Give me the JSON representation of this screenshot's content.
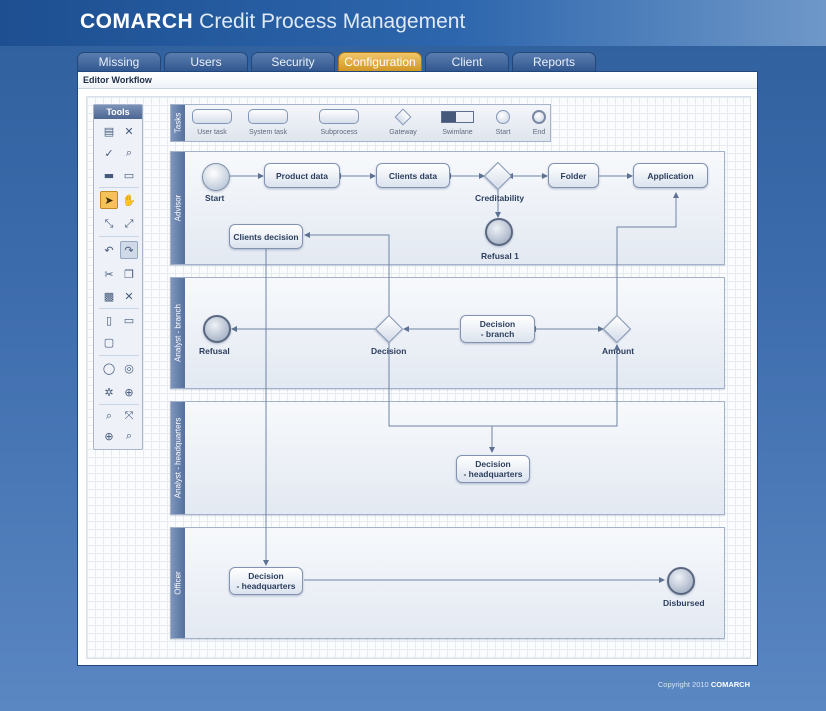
{
  "app": {
    "brand_strong": "COMARCH",
    "brand_rest": "Credit Process Management"
  },
  "tabs": [
    {
      "label": "Missing",
      "active": false
    },
    {
      "label": "Users",
      "active": false
    },
    {
      "label": "Security",
      "active": false
    },
    {
      "label": "Configuration",
      "active": true
    },
    {
      "label": "Client",
      "active": false
    },
    {
      "label": "Reports",
      "active": false
    }
  ],
  "breadcrumb": "Editor Workflow",
  "tools": {
    "title": "Tools",
    "items": [
      "save-icon",
      "tools-icon",
      "check-icon",
      "zoom-tool-icon",
      "open-icon",
      "display-icon",
      "pointer-icon",
      "hand-icon",
      "resize-icon",
      "expand-icon",
      "undo-icon",
      "redo-icon",
      "cut-icon",
      "copy-icon",
      "paste-icon",
      "delete-icon",
      "page-icon",
      "rectangle-icon",
      "rounded-rect-icon",
      "circle-icon",
      "circle-target-icon",
      "gear-icon",
      "move-icon",
      "zoom-out-icon",
      "fit-icon",
      "zoom-in-icon",
      "zoom-reset-icon"
    ]
  },
  "palette": {
    "label": "Tasks",
    "items": [
      "User task",
      "System task",
      "Subprocess",
      "Gateway",
      "Swimlane",
      "Start",
      "End"
    ]
  },
  "lanes": [
    "Advisor",
    "Analyst - branch",
    "Analyst - headquarters",
    "Officer"
  ],
  "nodes": {
    "product_data": "Product data",
    "clients_data": "Clients data",
    "folder": "Folder",
    "application": "Application",
    "clients_decision": "Clients decision",
    "decision_branch_1": "Decision",
    "decision_branch_2": "- branch",
    "decision_hq_1": "Decision",
    "decision_hq_2": "- headquarters",
    "officer_decision_1": "Decision",
    "officer_decision_2": "- headquarters"
  },
  "captions": {
    "start": "Start",
    "creditability": "Creditability",
    "refusal1": "Refusal 1",
    "refusal": "Refusal",
    "decision": "Decision",
    "amount": "Amount",
    "disbursed": "Disbursed"
  },
  "footer": {
    "text": "Copyright 2010",
    "brand": "COMARCH"
  },
  "colors": {
    "accent_tab": "#e0ad40",
    "header": "#1d4f91",
    "lane_label": "#6680ac"
  }
}
